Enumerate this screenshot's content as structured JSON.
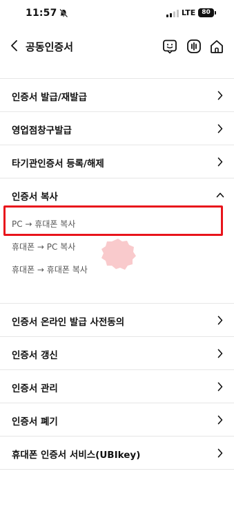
{
  "status_bar": {
    "time": "11:57",
    "network": "LTE",
    "battery": "80"
  },
  "header": {
    "title": "공동인증서"
  },
  "menu": {
    "items_top": [
      {
        "label": "인증서 발급/재발급"
      },
      {
        "label": "영업점창구발급"
      },
      {
        "label": "타기관인증서 등록/해제"
      }
    ],
    "expanded_section": {
      "label": "인증서 복사",
      "sub_items": [
        {
          "label": "PC → 휴대폰 복사"
        },
        {
          "label": "휴대폰 → PC 복사"
        },
        {
          "label": "휴대폰 → 휴대폰 복사"
        }
      ]
    },
    "items_bottom": [
      {
        "label": "인증서 온라인 발급 사전동의"
      },
      {
        "label": "인증서 갱신"
      },
      {
        "label": "인증서 관리"
      },
      {
        "label": "인증서 폐기"
      },
      {
        "label": "휴대폰 인증서 서비스(UBIkey)"
      }
    ]
  },
  "colors": {
    "highlight": "#e8141b",
    "divider": "#e6e6e6"
  }
}
